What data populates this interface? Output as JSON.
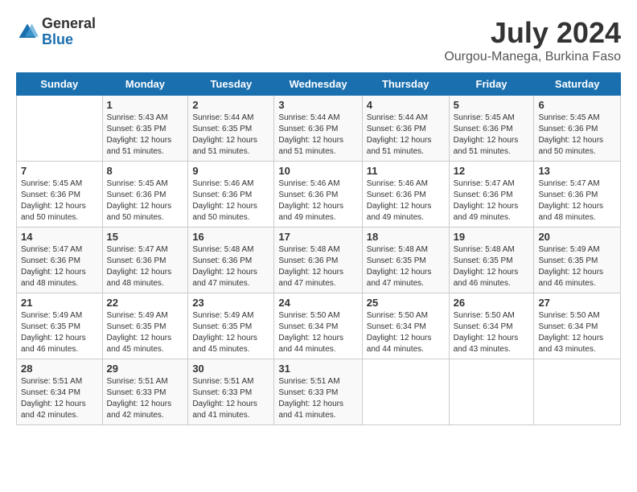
{
  "header": {
    "logo_general": "General",
    "logo_blue": "Blue",
    "month": "July 2024",
    "location": "Ourgou-Manega, Burkina Faso"
  },
  "days_of_week": [
    "Sunday",
    "Monday",
    "Tuesday",
    "Wednesday",
    "Thursday",
    "Friday",
    "Saturday"
  ],
  "weeks": [
    [
      {
        "day": "",
        "info": ""
      },
      {
        "day": "1",
        "info": "Sunrise: 5:43 AM\nSunset: 6:35 PM\nDaylight: 12 hours\nand 51 minutes."
      },
      {
        "day": "2",
        "info": "Sunrise: 5:44 AM\nSunset: 6:35 PM\nDaylight: 12 hours\nand 51 minutes."
      },
      {
        "day": "3",
        "info": "Sunrise: 5:44 AM\nSunset: 6:36 PM\nDaylight: 12 hours\nand 51 minutes."
      },
      {
        "day": "4",
        "info": "Sunrise: 5:44 AM\nSunset: 6:36 PM\nDaylight: 12 hours\nand 51 minutes."
      },
      {
        "day": "5",
        "info": "Sunrise: 5:45 AM\nSunset: 6:36 PM\nDaylight: 12 hours\nand 51 minutes."
      },
      {
        "day": "6",
        "info": "Sunrise: 5:45 AM\nSunset: 6:36 PM\nDaylight: 12 hours\nand 50 minutes."
      }
    ],
    [
      {
        "day": "7",
        "info": "Sunrise: 5:45 AM\nSunset: 6:36 PM\nDaylight: 12 hours\nand 50 minutes."
      },
      {
        "day": "8",
        "info": "Sunrise: 5:45 AM\nSunset: 6:36 PM\nDaylight: 12 hours\nand 50 minutes."
      },
      {
        "day": "9",
        "info": "Sunrise: 5:46 AM\nSunset: 6:36 PM\nDaylight: 12 hours\nand 50 minutes."
      },
      {
        "day": "10",
        "info": "Sunrise: 5:46 AM\nSunset: 6:36 PM\nDaylight: 12 hours\nand 49 minutes."
      },
      {
        "day": "11",
        "info": "Sunrise: 5:46 AM\nSunset: 6:36 PM\nDaylight: 12 hours\nand 49 minutes."
      },
      {
        "day": "12",
        "info": "Sunrise: 5:47 AM\nSunset: 6:36 PM\nDaylight: 12 hours\nand 49 minutes."
      },
      {
        "day": "13",
        "info": "Sunrise: 5:47 AM\nSunset: 6:36 PM\nDaylight: 12 hours\nand 48 minutes."
      }
    ],
    [
      {
        "day": "14",
        "info": "Sunrise: 5:47 AM\nSunset: 6:36 PM\nDaylight: 12 hours\nand 48 minutes."
      },
      {
        "day": "15",
        "info": "Sunrise: 5:47 AM\nSunset: 6:36 PM\nDaylight: 12 hours\nand 48 minutes."
      },
      {
        "day": "16",
        "info": "Sunrise: 5:48 AM\nSunset: 6:36 PM\nDaylight: 12 hours\nand 47 minutes."
      },
      {
        "day": "17",
        "info": "Sunrise: 5:48 AM\nSunset: 6:36 PM\nDaylight: 12 hours\nand 47 minutes."
      },
      {
        "day": "18",
        "info": "Sunrise: 5:48 AM\nSunset: 6:35 PM\nDaylight: 12 hours\nand 47 minutes."
      },
      {
        "day": "19",
        "info": "Sunrise: 5:48 AM\nSunset: 6:35 PM\nDaylight: 12 hours\nand 46 minutes."
      },
      {
        "day": "20",
        "info": "Sunrise: 5:49 AM\nSunset: 6:35 PM\nDaylight: 12 hours\nand 46 minutes."
      }
    ],
    [
      {
        "day": "21",
        "info": "Sunrise: 5:49 AM\nSunset: 6:35 PM\nDaylight: 12 hours\nand 46 minutes."
      },
      {
        "day": "22",
        "info": "Sunrise: 5:49 AM\nSunset: 6:35 PM\nDaylight: 12 hours\nand 45 minutes."
      },
      {
        "day": "23",
        "info": "Sunrise: 5:49 AM\nSunset: 6:35 PM\nDaylight: 12 hours\nand 45 minutes."
      },
      {
        "day": "24",
        "info": "Sunrise: 5:50 AM\nSunset: 6:34 PM\nDaylight: 12 hours\nand 44 minutes."
      },
      {
        "day": "25",
        "info": "Sunrise: 5:50 AM\nSunset: 6:34 PM\nDaylight: 12 hours\nand 44 minutes."
      },
      {
        "day": "26",
        "info": "Sunrise: 5:50 AM\nSunset: 6:34 PM\nDaylight: 12 hours\nand 43 minutes."
      },
      {
        "day": "27",
        "info": "Sunrise: 5:50 AM\nSunset: 6:34 PM\nDaylight: 12 hours\nand 43 minutes."
      }
    ],
    [
      {
        "day": "28",
        "info": "Sunrise: 5:51 AM\nSunset: 6:34 PM\nDaylight: 12 hours\nand 42 minutes."
      },
      {
        "day": "29",
        "info": "Sunrise: 5:51 AM\nSunset: 6:33 PM\nDaylight: 12 hours\nand 42 minutes."
      },
      {
        "day": "30",
        "info": "Sunrise: 5:51 AM\nSunset: 6:33 PM\nDaylight: 12 hours\nand 41 minutes."
      },
      {
        "day": "31",
        "info": "Sunrise: 5:51 AM\nSunset: 6:33 PM\nDaylight: 12 hours\nand 41 minutes."
      },
      {
        "day": "",
        "info": ""
      },
      {
        "day": "",
        "info": ""
      },
      {
        "day": "",
        "info": ""
      }
    ]
  ]
}
